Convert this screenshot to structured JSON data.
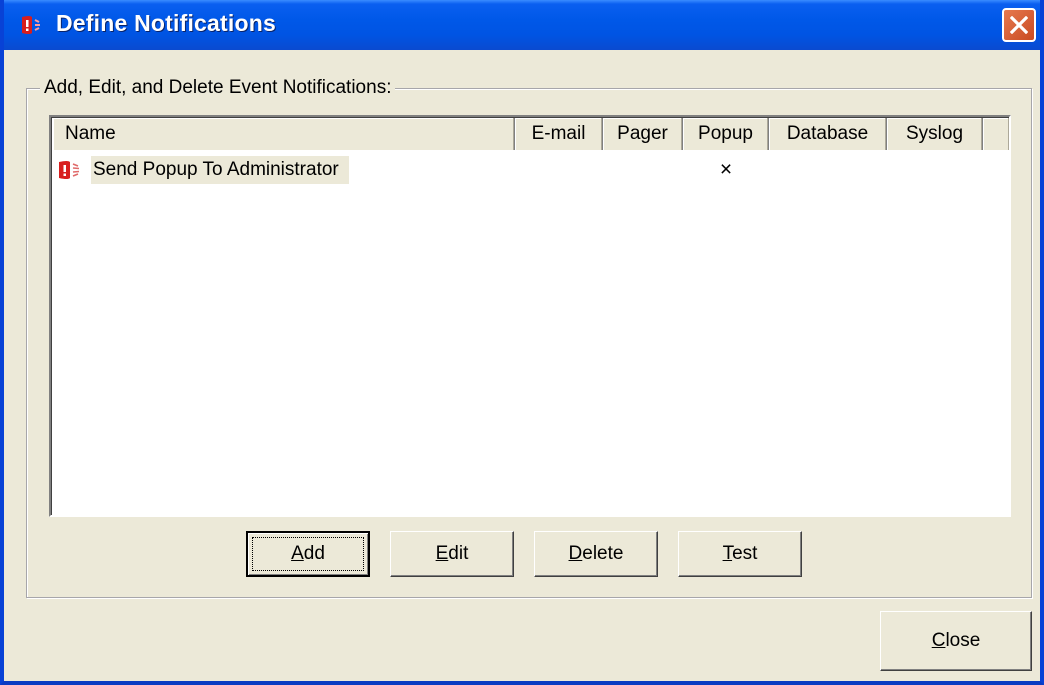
{
  "window": {
    "title": "Define Notifications",
    "titlebar_color": "#0054e3"
  },
  "group": {
    "label": "Add, Edit, and Delete Event Notifications:"
  },
  "list": {
    "columns": [
      "Name",
      "E-mail",
      "Pager",
      "Popup",
      "Database",
      "Syslog"
    ],
    "rows": [
      {
        "icon": "alarm-notification-icon",
        "name": "Send Popup To Administrator",
        "email": "",
        "pager": "",
        "popup": "×",
        "database": "",
        "syslog": ""
      }
    ]
  },
  "buttons": {
    "add": {
      "access_key": "A",
      "rest": "dd"
    },
    "edit": {
      "access_key": "E",
      "rest": "dit"
    },
    "delete": {
      "access_key": "D",
      "rest": "elete"
    },
    "test": {
      "access_key": "T",
      "rest": "est"
    },
    "close": {
      "access_key": "C",
      "rest": "lose"
    }
  },
  "icons": {
    "title": "alarm-notification-icon",
    "close": "close-icon"
  }
}
